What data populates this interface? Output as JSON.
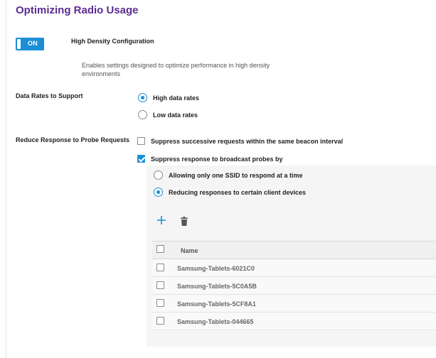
{
  "section": {
    "title": "Optimizing Radio Usage"
  },
  "high_density": {
    "toggle_state": "ON",
    "label": "High Density Configuration",
    "description": "Enables settings designed to optimize performance in high density environments"
  },
  "data_rates": {
    "label": "Data Rates to Support",
    "options": [
      {
        "label": "High data rates",
        "selected": true
      },
      {
        "label": "Low data rates",
        "selected": false
      }
    ]
  },
  "probe": {
    "label": "Reduce Response to Probe Requests",
    "suppress_successive": {
      "label": "Suppress successive requests within the same beacon interval",
      "checked": false
    },
    "suppress_broadcast": {
      "label": "Suppress response to broadcast probes by",
      "checked": true
    },
    "broadcast_options": [
      {
        "label": "Allowing only one SSID to respond at a time",
        "selected": false
      },
      {
        "label": "Reducing responses to certain client devices",
        "selected": true
      }
    ],
    "toolbar": {
      "add_icon": "plus-icon",
      "delete_icon": "trash-icon"
    },
    "table": {
      "header": "Name",
      "rows": [
        "Samsung-Tablets-6021C0",
        "Samsung-Tablets-5C0A5B",
        "Samsung-Tablets-5CF8A1",
        "Samsung-Tablets-044665"
      ]
    }
  },
  "colors": {
    "title": "#5b2c91",
    "accent": "#1a8fd6"
  }
}
